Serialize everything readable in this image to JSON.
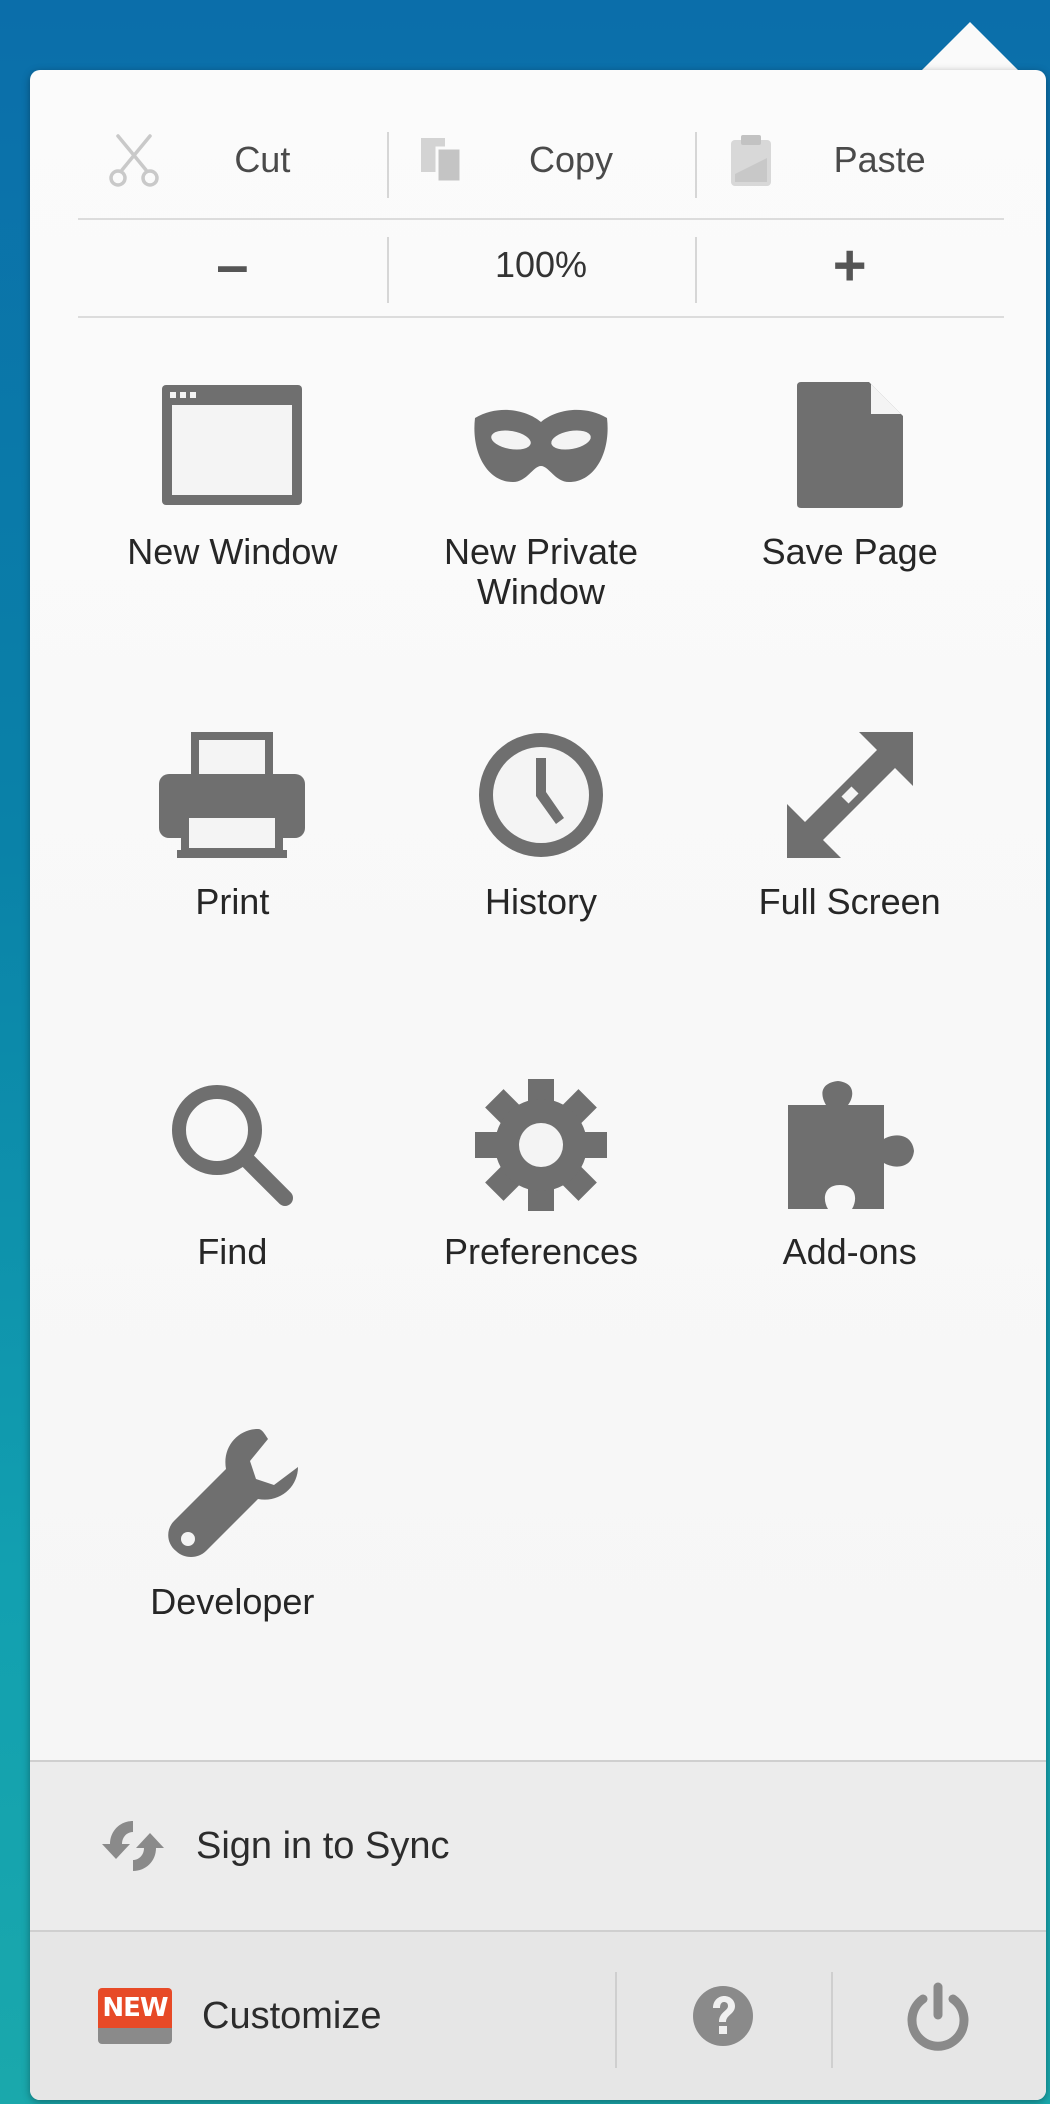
{
  "edit": {
    "cut": "Cut",
    "copy": "Copy",
    "paste": "Paste"
  },
  "zoom": {
    "minus": "–",
    "level": "100%",
    "plus": "+"
  },
  "grid": {
    "new_window": "New Window",
    "new_private_window": "New Private Window",
    "save_page": "Save Page",
    "print": "Print",
    "history": "History",
    "full_screen": "Full Screen",
    "find": "Find",
    "preferences": "Preferences",
    "addons": "Add-ons",
    "developer": "Developer"
  },
  "sync": {
    "label": "Sign in to Sync"
  },
  "footer": {
    "customize": "Customize",
    "new_badge": "NEW"
  },
  "colors": {
    "icon_gray": "#6f6f6f",
    "badge_red": "#e74a27",
    "background_blue": "#0b6eaa"
  }
}
